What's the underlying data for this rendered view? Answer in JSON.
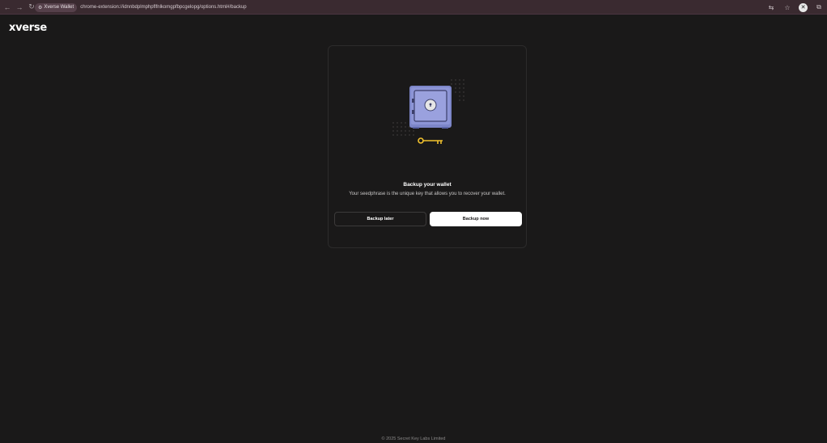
{
  "browser": {
    "back_icon": "arrow-left-icon",
    "forward_icon": "arrow-right-icon",
    "reload_icon": "reload-icon",
    "tab_chip": "Xverse Wallet",
    "url": "chrome-extension://idnnbdplmphpflfnlkomgpfbpcgelopg/options.html#/backup"
  },
  "app": {
    "logo": "xverse"
  },
  "card": {
    "title": "Backup your wallet",
    "subtitle": "Your seedphrase is the unique key that allows you to recover your wallet.",
    "backup_later": "Backup later",
    "backup_now": "Backup now"
  },
  "footer": {
    "text": "© 2025 Secret Key Labs Limited"
  },
  "colors": {
    "background": "#1a1919",
    "safe": "#8d95d6",
    "key": "#f2c22e",
    "primary_button": "#ffffff"
  }
}
